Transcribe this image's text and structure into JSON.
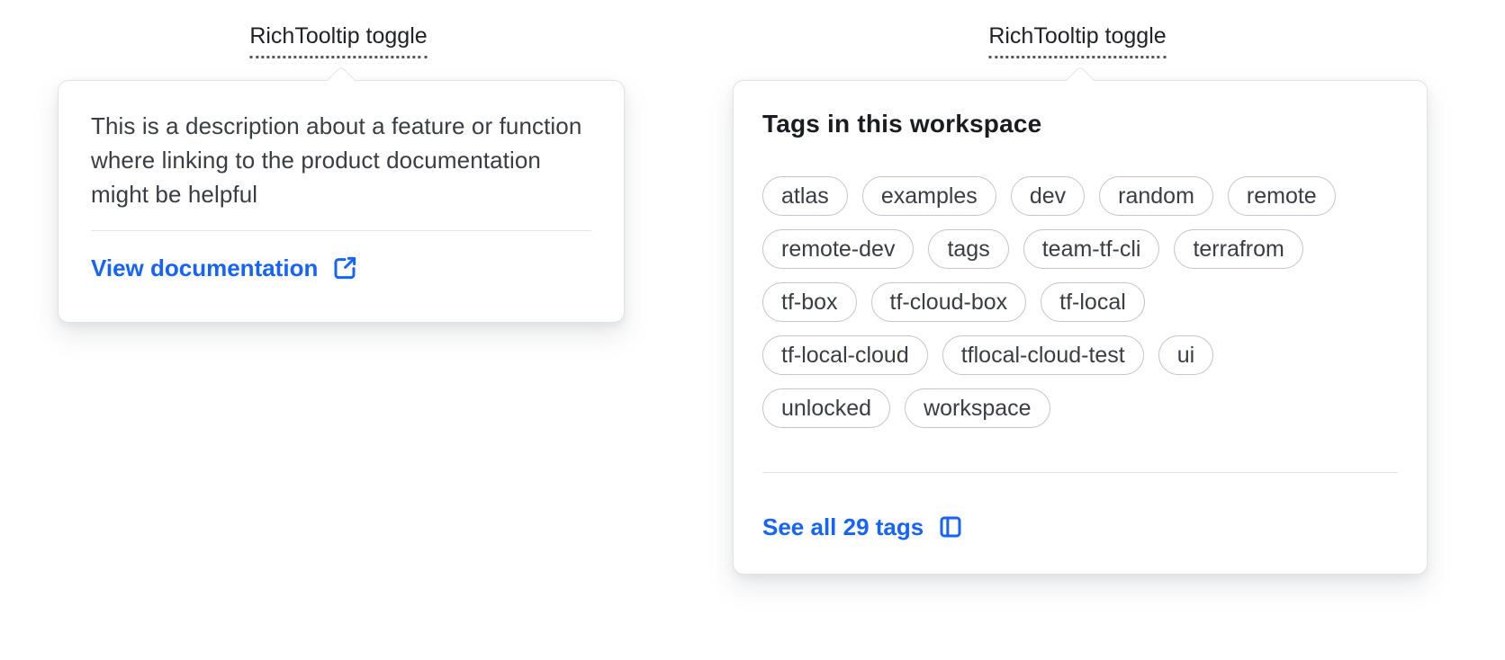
{
  "colors": {
    "accent": "#1563ff",
    "text": "#3b3d45",
    "card_border": "#e1e3e7"
  },
  "tooltips": [
    {
      "toggle_label": "RichTooltip toggle",
      "description": "This is a description about a feature or function where linking to the product documentation might be helpful",
      "link_label": "View documentation",
      "link_icon": "external-link-icon"
    },
    {
      "toggle_label": "RichTooltip toggle",
      "heading": "Tags in this workspace",
      "tag_rows": [
        [
          "atlas",
          "examples",
          "dev",
          "random",
          "remote"
        ],
        [
          "remote-dev",
          "tags",
          "team-tf-cli",
          "terrafrom"
        ],
        [
          "tf-box",
          "tf-cloud-box",
          "tf-local"
        ],
        [
          "tf-local-cloud",
          "tflocal-cloud-test",
          "ui"
        ],
        [
          "unlocked",
          "workspace"
        ]
      ],
      "link_label": "See all 29 tags",
      "link_icon": "sidebar-icon"
    }
  ]
}
